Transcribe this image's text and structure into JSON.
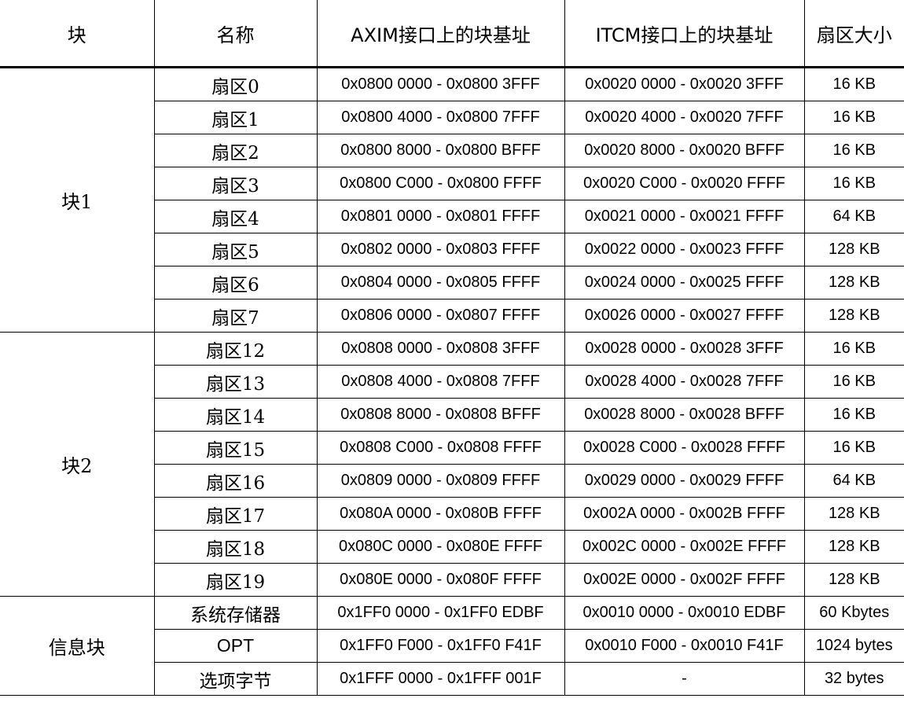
{
  "headers": [
    "块",
    "名称",
    "AXIM接口上的块基址",
    "ITCM接口上的块基址",
    "扇区大小"
  ],
  "groups": [
    {
      "block": "块1",
      "rows": [
        {
          "name": "扇区0",
          "axim": "0x0800 0000 - 0x0800 3FFF",
          "itcm": "0x0020 0000 - 0x0020 3FFF",
          "size": "16 KB"
        },
        {
          "name": "扇区1",
          "axim": "0x0800 4000 - 0x0800 7FFF",
          "itcm": "0x0020 4000 - 0x0020 7FFF",
          "size": "16 KB"
        },
        {
          "name": "扇区2",
          "axim": "0x0800 8000 - 0x0800 BFFF",
          "itcm": "0x0020 8000 - 0x0020 BFFF",
          "size": "16 KB"
        },
        {
          "name": "扇区3",
          "axim": "0x0800 C000 - 0x0800 FFFF",
          "itcm": "0x0020 C000 - 0x0020 FFFF",
          "size": "16 KB"
        },
        {
          "name": "扇区4",
          "axim": "0x0801 0000 - 0x0801 FFFF",
          "itcm": "0x0021 0000 - 0x0021 FFFF",
          "size": "64 KB"
        },
        {
          "name": "扇区5",
          "axim": "0x0802 0000 - 0x0803 FFFF",
          "itcm": "0x0022 0000 - 0x0023 FFFF",
          "size": "128 KB"
        },
        {
          "name": "扇区6",
          "axim": "0x0804 0000 - 0x0805 FFFF",
          "itcm": "0x0024 0000 - 0x0025 FFFF",
          "size": "128 KB"
        },
        {
          "name": "扇区7",
          "axim": "0x0806 0000 - 0x0807 FFFF",
          "itcm": "0x0026 0000 - 0x0027 FFFF",
          "size": "128 KB"
        }
      ]
    },
    {
      "block": "块2",
      "rows": [
        {
          "name": "扇区12",
          "axim": "0x0808 0000 - 0x0808 3FFF",
          "itcm": "0x0028 0000 - 0x0028 3FFF",
          "size": "16 KB"
        },
        {
          "name": "扇区13",
          "axim": "0x0808 4000 - 0x0808 7FFF",
          "itcm": "0x0028 4000 - 0x0028 7FFF",
          "size": "16 KB"
        },
        {
          "name": "扇区14",
          "axim": "0x0808 8000 - 0x0808 BFFF",
          "itcm": "0x0028 8000 - 0x0028 BFFF",
          "size": "16 KB"
        },
        {
          "name": "扇区15",
          "axim": "0x0808 C000 - 0x0808 FFFF",
          "itcm": "0x0028 C000 - 0x0028 FFFF",
          "size": "16 KB"
        },
        {
          "name": "扇区16",
          "axim": "0x0809 0000 - 0x0809 FFFF",
          "itcm": "0x0029 0000 - 0x0029 FFFF",
          "size": "64 KB"
        },
        {
          "name": "扇区17",
          "axim": "0x080A 0000 - 0x080B FFFF",
          "itcm": "0x002A 0000 - 0x002B FFFF",
          "size": "128 KB"
        },
        {
          "name": "扇区18",
          "axim": "0x080C 0000 - 0x080E FFFF",
          "itcm": "0x002C 0000 - 0x002E FFFF",
          "size": "128 KB"
        },
        {
          "name": "扇区19",
          "axim": "0x080E 0000 - 0x080F FFFF",
          "itcm": "0x002E 0000 - 0x002F FFFF",
          "size": "128 KB"
        }
      ]
    },
    {
      "block": "信息块",
      "rows": [
        {
          "name": "系统存储器",
          "axim": "0x1FF0 0000 - 0x1FF0 EDBF",
          "itcm": "0x0010 0000 - 0x0010 EDBF",
          "size": "60 Kbytes"
        },
        {
          "name": "OPT",
          "axim": "0x1FF0 F000 - 0x1FF0 F41F",
          "itcm": "0x0010 F000 - 0x0010 F41F",
          "size": "1024 bytes"
        },
        {
          "name": "选项字节",
          "axim": "0x1FFF 0000 - 0x1FFF 001F",
          "itcm": "-",
          "size": "32 bytes"
        }
      ]
    }
  ]
}
